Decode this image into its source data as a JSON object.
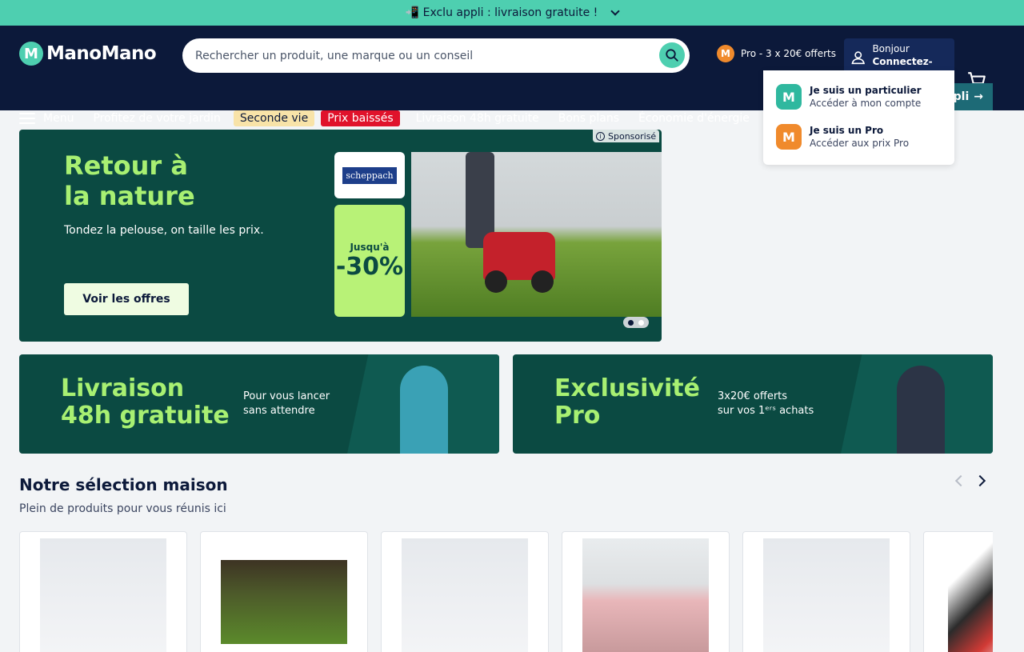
{
  "promo_bar": {
    "text": "📲 Exclu appli : livraison gratuite !"
  },
  "header": {
    "logo_text": "ManoMano",
    "logo_mark": "M",
    "search_placeholder": "Rechercher un produit, une marque ou un conseil",
    "pro_link": "Pro - 3 x 20€ offerts",
    "pro_badge": "M",
    "account_greeting": "Bonjour",
    "account_action": "Connectez-vous"
  },
  "nav": {
    "menu_label": "Menu",
    "items": [
      "Profitez de votre jardin",
      "Seconde vie",
      "Prix baissés",
      "Livraison 48h gratuite",
      "Bons plans",
      "Économie d'énergie"
    ],
    "appli_label": "pli"
  },
  "account_dropdown": {
    "items": [
      {
        "title": "Je suis un particulier",
        "subtitle": "Accéder à mon compte",
        "icon": "M"
      },
      {
        "title": "Je suis un Pro",
        "subtitle": "Accéder aux prix Pro",
        "icon": "M"
      }
    ]
  },
  "hero": {
    "title_line1": "Retour à",
    "title_line2": "la nature",
    "subtitle": "Tondez la pelouse, on taille les prix.",
    "cta": "Voir les offres",
    "brand": "scheppach",
    "discount_label": "Jusqu'à",
    "discount_value": "-30%",
    "sponsored": "Sponsorisé",
    "slides": 2,
    "active_slide": 1
  },
  "promo_cards": [
    {
      "title_line1": "Livraison",
      "title_line2": "48h gratuite",
      "desc_line1": "Pour vous lancer",
      "desc_line2": "sans attendre"
    },
    {
      "title_line1": "Exclusivité",
      "title_line2": "Pro",
      "desc_line1": "3x20€ offerts",
      "desc_line2": "sur vos 1ᵉʳˢ achats"
    }
  ],
  "selection": {
    "title": "Notre sélection maison",
    "subtitle": "Plein de produits pour vous réunis ici"
  },
  "colors": {
    "brand_teal": "#4ecfb0",
    "header_navy": "#0c193a",
    "hero_green": "#0b4a42",
    "accent_lime": "#a8f072",
    "sale_red": "#e0122b",
    "pro_orange": "#f08a2c"
  }
}
